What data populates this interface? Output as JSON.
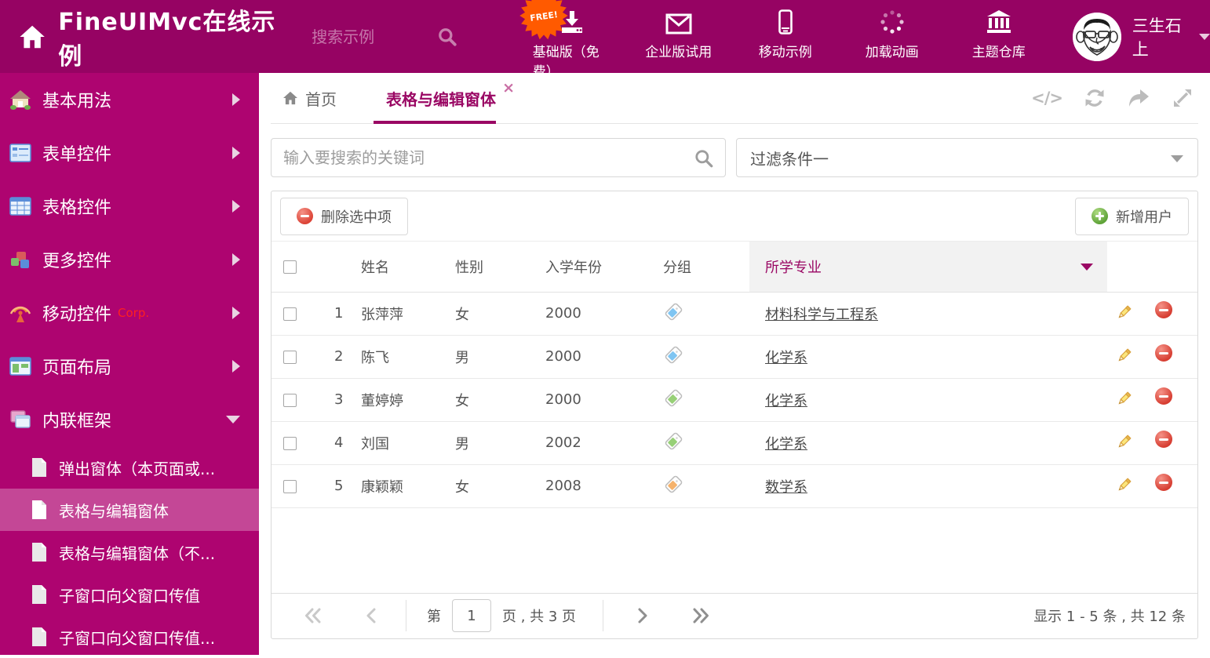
{
  "header": {
    "title": "FineUIMvc在线示例",
    "search_placeholder": "搜索示例",
    "free_badge": "FREE!",
    "nav_items": [
      {
        "label": "基础版（免费）",
        "icon": "download-icon"
      },
      {
        "label": "企业版试用",
        "icon": "envelope-icon"
      },
      {
        "label": "移动示例",
        "icon": "mobile-icon"
      },
      {
        "label": "加载动画",
        "icon": "spinner-icon"
      },
      {
        "label": "主题仓库",
        "icon": "bank-icon"
      }
    ],
    "username": "三生石上"
  },
  "sidebar": {
    "items": [
      {
        "label": "基本用法"
      },
      {
        "label": "表单控件"
      },
      {
        "label": "表格控件"
      },
      {
        "label": "更多控件"
      },
      {
        "label": "移动控件",
        "badge": "Corp."
      },
      {
        "label": "页面布局"
      },
      {
        "label": "内联框架"
      }
    ],
    "subitems": [
      {
        "label": "弹出窗体（本页面或..."
      },
      {
        "label": "表格与编辑窗体"
      },
      {
        "label": "表格与编辑窗体（不..."
      },
      {
        "label": "子窗口向父窗口传值"
      },
      {
        "label": "子窗口向父窗口传值..."
      }
    ]
  },
  "tabs": {
    "home": "首页",
    "active": "表格与编辑窗体"
  },
  "filter": {
    "search_placeholder": "输入要搜索的关键词",
    "dropdown_value": "过滤条件一"
  },
  "toolbar": {
    "delete_label": "删除选中项",
    "add_label": "新增用户"
  },
  "table": {
    "columns": {
      "name": "姓名",
      "gender": "性别",
      "year": "入学年份",
      "group": "分组",
      "major": "所学专业"
    },
    "rows": [
      {
        "num": "1",
        "name": "张萍萍",
        "gender": "女",
        "year": "2000",
        "tag_color": "#7FC5F2",
        "major": "材料科学与工程系"
      },
      {
        "num": "2",
        "name": "陈飞",
        "gender": "男",
        "year": "2000",
        "tag_color": "#7FC5F2",
        "major": "化学系"
      },
      {
        "num": "3",
        "name": "董婷婷",
        "gender": "女",
        "year": "2000",
        "tag_color": "#97D077",
        "major": "化学系"
      },
      {
        "num": "4",
        "name": "刘国",
        "gender": "男",
        "year": "2002",
        "tag_color": "#97D077",
        "major": "化学系"
      },
      {
        "num": "5",
        "name": "康颖颖",
        "gender": "女",
        "year": "2008",
        "tag_color": "#F5B26B",
        "major": "数学系"
      }
    ]
  },
  "pagination": {
    "prefix": "第",
    "page": "1",
    "suffix": "页 , 共 3 页",
    "summary": "显示 1 - 5 条 , 共 12 条"
  },
  "colors": {
    "header_bg": "#960363",
    "sidebar_bg": "#AE0470",
    "accent": "#9A0864",
    "free_badge": "#FF5A00",
    "corp_red": "#FF2020",
    "tag_blue": "#7FC5F2",
    "tag_green": "#97D077",
    "tag_orange": "#F5B26B",
    "delete_red": "#DC4437",
    "add_green": "#5FA339"
  }
}
